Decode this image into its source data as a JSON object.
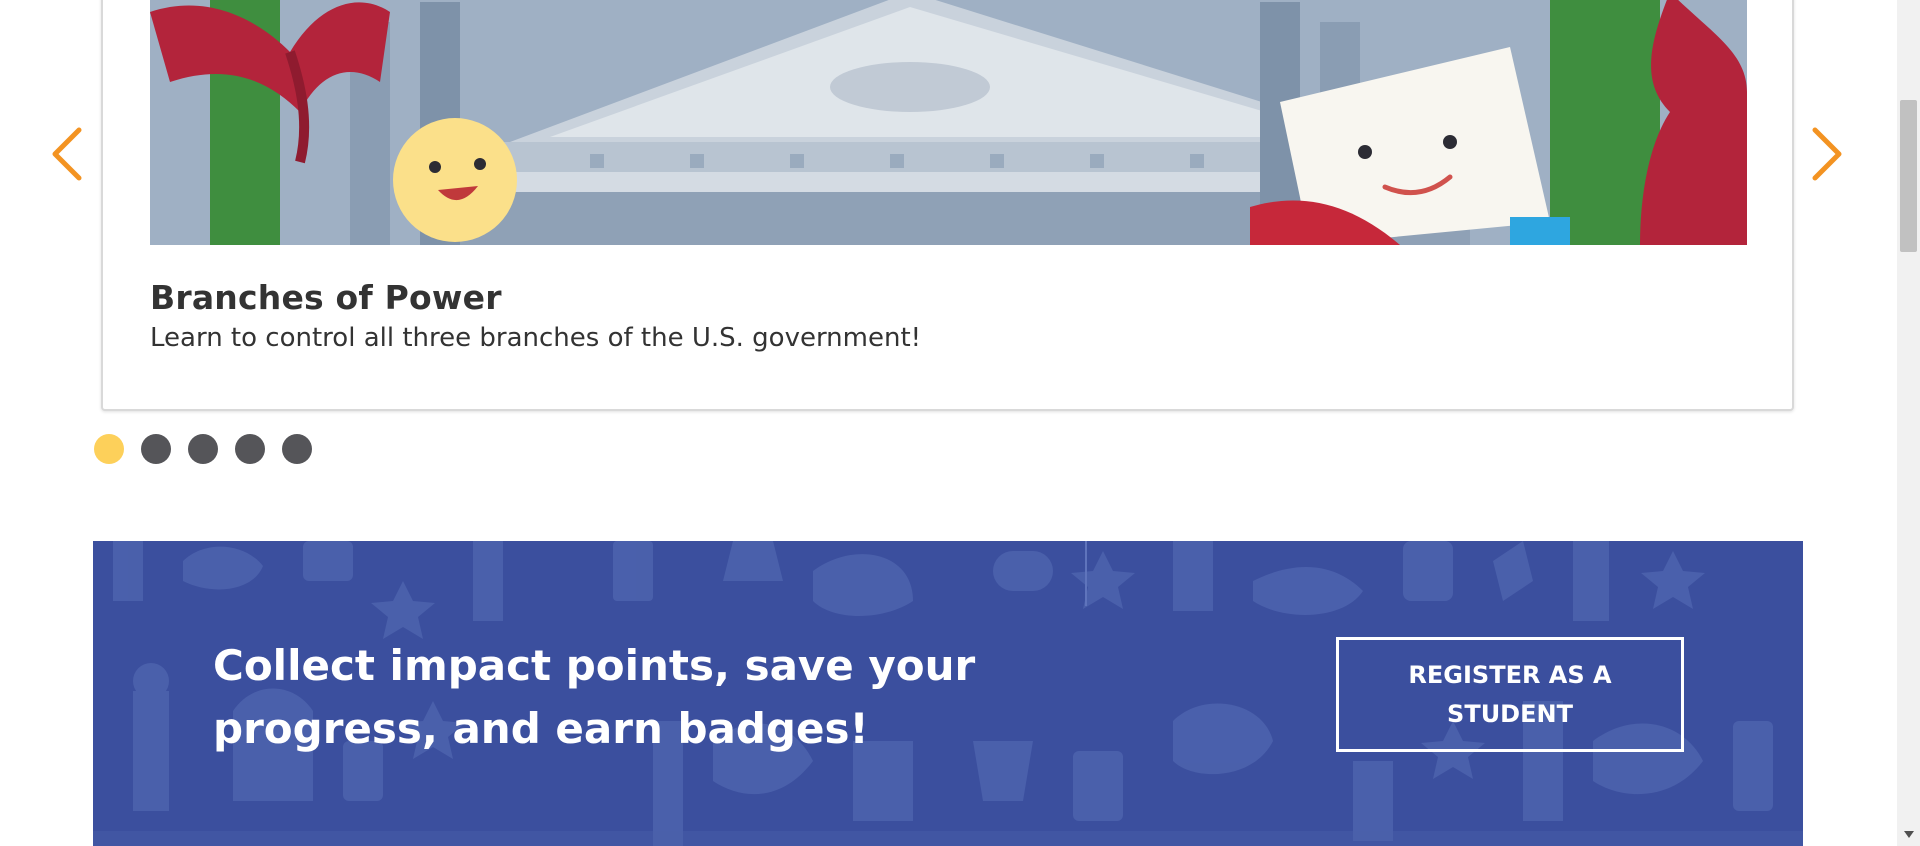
{
  "carousel": {
    "slide": {
      "title": "Branches of Power",
      "description": "Learn to control all three branches of the U.S. government!"
    },
    "prev_icon": "chevron-left",
    "next_icon": "chevron-right",
    "dot_count": 5,
    "active_dot": 1,
    "colors": {
      "arrow": "#f39322",
      "active_dot": "#fdd05a",
      "dot": "#555559"
    }
  },
  "banner": {
    "heading": "Collect impact points, save your progress, and earn badges!",
    "register_label": "REGISTER AS A STUDENT",
    "colors": {
      "background": "#3b4f9e",
      "pattern": "#5066b0"
    }
  }
}
